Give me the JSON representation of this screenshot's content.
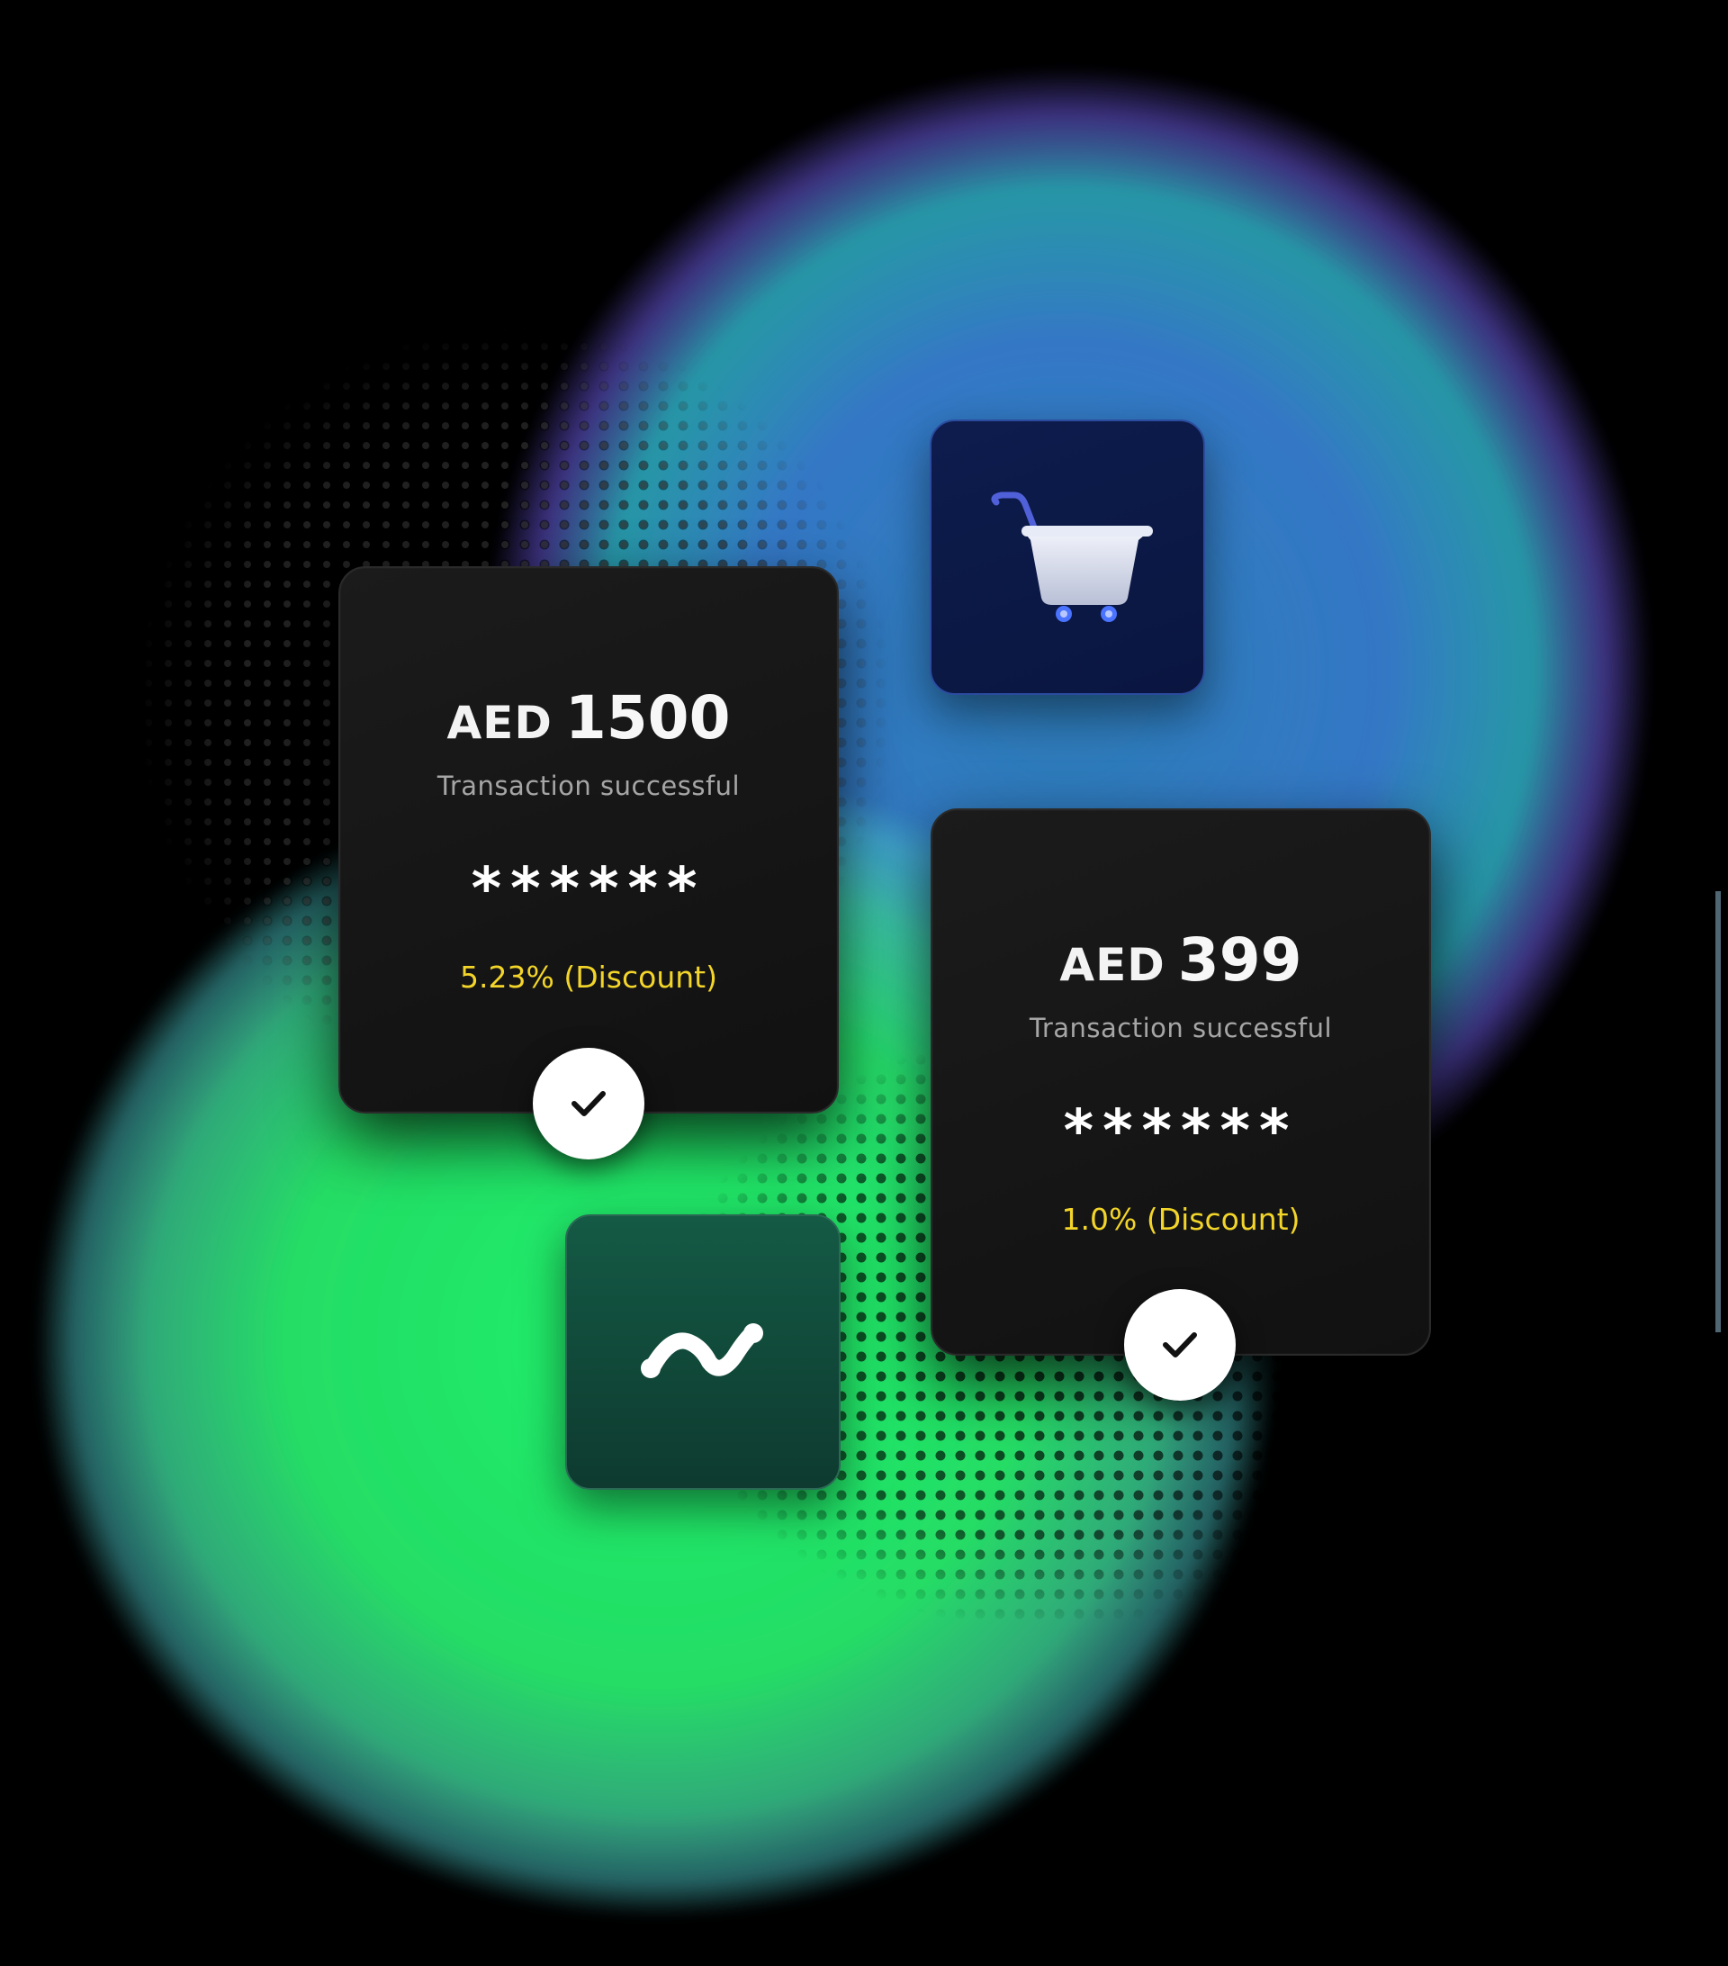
{
  "cards": [
    {
      "currency": "AED",
      "amount": "1500",
      "status": "Transaction successful",
      "masked_value": "******",
      "discount": "5.23% (Discount)"
    },
    {
      "currency": "AED",
      "amount": "399",
      "status": "Transaction successful",
      "masked_value": "******",
      "discount": "1.0% (Discount)"
    }
  ],
  "icons": {
    "tile_top": "shopping-cart-icon",
    "tile_bottom": "trend-line-icon",
    "badges": "check-icon"
  },
  "colors": {
    "discount": "#f3d52a",
    "card_background": "#161616",
    "cart_tile": "#0d1c4d",
    "trend_tile": "#145a45",
    "glow_green": "#22f56a",
    "glow_blue": "#4a9df5"
  }
}
